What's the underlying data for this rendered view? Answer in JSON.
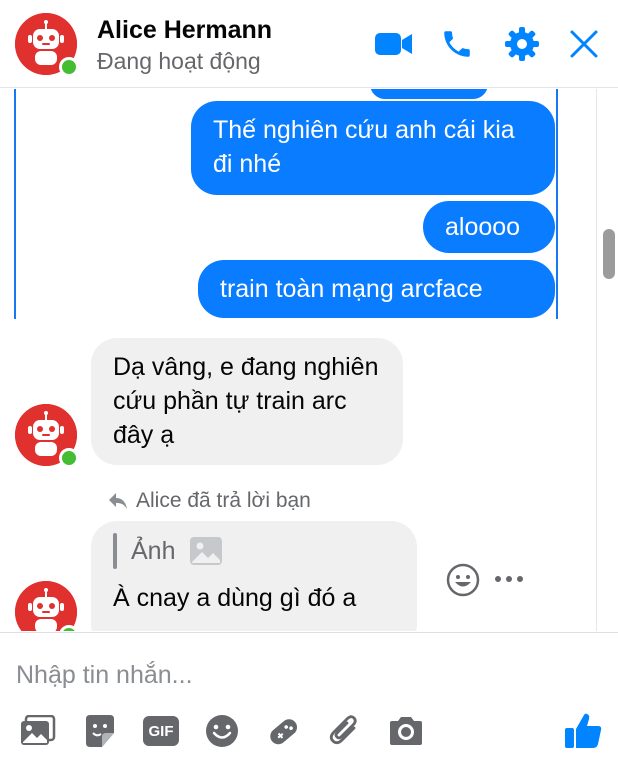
{
  "contact": {
    "name": "Alice Hermann",
    "status": "Đang hoạt động"
  },
  "header_icons": [
    "video-call-icon",
    "voice-call-icon",
    "settings-icon",
    "close-icon"
  ],
  "messages": {
    "out_1": "Thế nghiên cứu anh cái kia đi nhé",
    "out_2": "aloooo",
    "out_3": "train toàn mạng arcface",
    "in_1": "Dạ vâng, e đang nghiên cứu phần tự train arc đây ạ",
    "reply_note": "Alice đã trả lời bạn",
    "quoted_label": "Ảnh",
    "in_2": "À cnay a dùng gì đó a"
  },
  "composer": {
    "placeholder": "Nhập tin nhắn...",
    "tools": [
      "photo-icon",
      "sticker-icon",
      "gif-icon",
      "emoji-icon",
      "game-icon",
      "attach-icon",
      "camera-icon",
      "like-icon"
    ],
    "gif_label": "GIF"
  },
  "colors": {
    "brand": "#0084ff",
    "outgoing_bubble": "#0a7cff",
    "incoming_bubble": "#f0f0f0",
    "online": "#44bd32",
    "avatar": "#e0312f"
  }
}
